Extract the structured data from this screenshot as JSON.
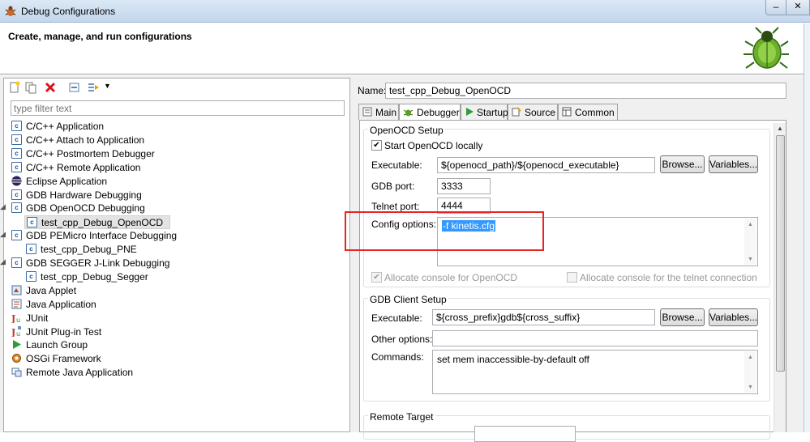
{
  "window": {
    "title": "Debug Configurations",
    "title_ghost": "                                                         ",
    "minimize_label": "–",
    "close_label": "✕"
  },
  "banner": {
    "heading": "Create, manage, and run configurations",
    "icon": "bug-icon"
  },
  "left": {
    "filter_placeholder": "type filter text",
    "toolbar": [
      "new-config-icon",
      "duplicate-icon",
      "delete-icon",
      "collapse-all-icon",
      "filter-icon"
    ],
    "tree": [
      {
        "label": "C/C++ Application",
        "level": 0,
        "icon": "c-config-icon"
      },
      {
        "label": "C/C++ Attach to Application",
        "level": 0,
        "icon": "c-config-icon"
      },
      {
        "label": "C/C++ Postmortem Debugger",
        "level": 0,
        "icon": "c-config-icon"
      },
      {
        "label": "C/C++ Remote Application",
        "level": 0,
        "icon": "c-config-icon"
      },
      {
        "label": "Eclipse Application",
        "level": 0,
        "icon": "eclipse-icon"
      },
      {
        "label": "GDB Hardware Debugging",
        "level": 0,
        "icon": "c-config-icon"
      },
      {
        "label": "GDB OpenOCD Debugging",
        "level": 0,
        "icon": "c-config-icon",
        "expanded": true
      },
      {
        "label": "test_cpp_Debug_OpenOCD",
        "level": 1,
        "icon": "c-config-icon",
        "selected": true
      },
      {
        "label": "GDB PEMicro Interface Debugging",
        "level": 0,
        "icon": "c-config-icon",
        "expanded": true
      },
      {
        "label": "test_cpp_Debug_PNE",
        "level": 1,
        "icon": "c-config-icon"
      },
      {
        "label": "GDB SEGGER J-Link Debugging",
        "level": 0,
        "icon": "c-config-icon",
        "expanded": true
      },
      {
        "label": "test_cpp_Debug_Segger",
        "level": 1,
        "icon": "c-config-icon"
      },
      {
        "label": "Java Applet",
        "level": 0,
        "icon": "java-applet-icon"
      },
      {
        "label": "Java Application",
        "level": 0,
        "icon": "java-app-icon"
      },
      {
        "label": "JUnit",
        "level": 0,
        "icon": "junit-icon"
      },
      {
        "label": "JUnit Plug-in Test",
        "level": 0,
        "icon": "junit-plugin-icon"
      },
      {
        "label": "Launch Group",
        "level": 0,
        "icon": "launch-group-icon"
      },
      {
        "label": "OSGi Framework",
        "level": 0,
        "icon": "osgi-icon"
      },
      {
        "label": "Remote Java Application",
        "level": 0,
        "icon": "remote-java-icon"
      }
    ]
  },
  "right": {
    "name_label": "Name:",
    "name_value": "test_cpp_Debug_OpenOCD",
    "tabs": [
      {
        "label": "Main",
        "icon": "main-tab-icon"
      },
      {
        "label": "Debugger",
        "icon": "debugger-tab-icon",
        "active": true
      },
      {
        "label": "Startup",
        "icon": "startup-tab-icon"
      },
      {
        "label": "Source",
        "icon": "source-tab-icon"
      },
      {
        "label": "Common",
        "icon": "common-tab-icon"
      }
    ],
    "openocd": {
      "title": "OpenOCD Setup",
      "start_label": "Start OpenOCD locally",
      "start_checked": true,
      "exec_label": "Executable:",
      "exec_value": "${openocd_path}/${openocd_executable}",
      "browse_label": "Browse...",
      "variables_label": "Variables...",
      "gdb_port_label": "GDB port:",
      "gdb_port_value": "3333",
      "telnet_port_label": "Telnet port:",
      "telnet_port_value": "4444",
      "config_label": "Config options:",
      "config_value": "-f kinetis.cfg",
      "alloc_openocd_label": "Allocate console for OpenOCD",
      "alloc_telnet_label": "Allocate console for the telnet connection"
    },
    "gdbclient": {
      "title": "GDB Client Setup",
      "exec_label": "Executable:",
      "exec_value": "${cross_prefix}gdb${cross_suffix}",
      "browse_label": "Browse...",
      "variables_label": "Variables...",
      "other_label": "Other options:",
      "other_value": "",
      "commands_label": "Commands:",
      "commands_value": "set mem inaccessible-by-default off"
    },
    "remote": {
      "title": "Remote Target"
    }
  }
}
